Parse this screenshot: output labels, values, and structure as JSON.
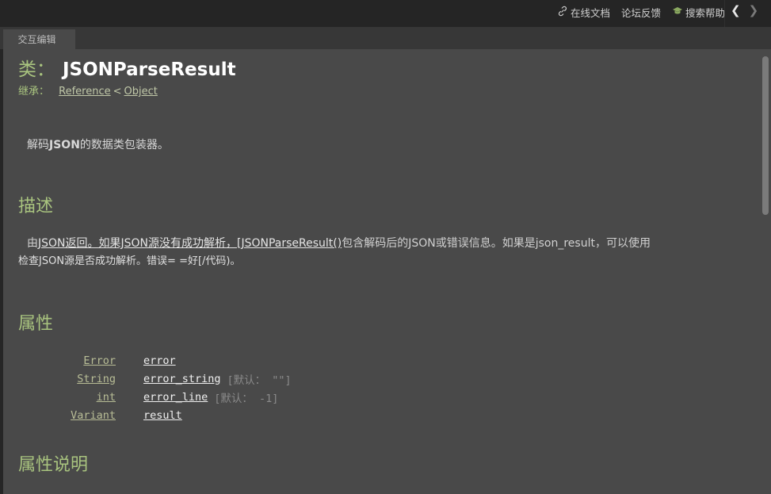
{
  "topbar": {
    "actions": [
      {
        "icon": "link-icon",
        "label": "在线文档"
      },
      {
        "icon": "",
        "label": "论坛反馈"
      },
      {
        "icon": "graduation-cap-icon",
        "label": "搜索帮助"
      }
    ],
    "back": "❮",
    "forward": "❯"
  },
  "tabs": [
    {
      "label": "交互编辑"
    }
  ],
  "page": {
    "class_keyword": "类：",
    "class_name": "JSONParseResult",
    "inherits_label": "继承：",
    "inherits": [
      "Reference",
      "Object"
    ],
    "inherits_sep": "<",
    "brief_pre": "解码",
    "brief_bold": "JSON",
    "brief_post": "的数据类包装器。",
    "description_heading": "描述",
    "description_line1_pre": "由",
    "description_line1_underlined": "JSON返回。如果JSON源没有成功解析，[JSONParseResult()",
    "description_line1_post": "包含解码后的JSON或错误信息。如果是json_result，可以使用",
    "description_line2": "检查JSON源是否成功解析。错误= =好[/代码)。",
    "properties_heading": "属性",
    "properties": [
      {
        "type": "Error",
        "name": "error",
        "default": ""
      },
      {
        "type": "String",
        "name": "error_string",
        "default": "[默认： \"\"]"
      },
      {
        "type": "int",
        "name": "error_line",
        "default": "[默认： -1]"
      },
      {
        "type": "Variant",
        "name": "result",
        "default": ""
      }
    ],
    "property_desc_heading": "属性说明"
  },
  "colors": {
    "accent": "#a9c47f",
    "background": "#494949",
    "topbar": "#252525"
  }
}
